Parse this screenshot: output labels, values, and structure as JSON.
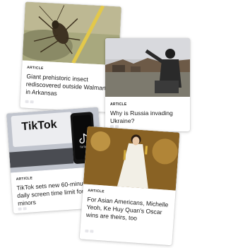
{
  "articles": [
    {
      "tag": "ARTICLE",
      "title": "Giant prehistoric insect rediscovered outside Walmart in Arkansas",
      "image": "insect-photo"
    },
    {
      "tag": "ARTICLE",
      "title": "Why is Russia invading Ukraine?",
      "image": "war-soldier-photo"
    },
    {
      "tag": "ARTICLE",
      "title": "TikTok sets new 60-minute daily screen time limit for minors",
      "image": "tiktok-phone-photo"
    },
    {
      "tag": "ARTICLE",
      "title": "For Asian Americans, Michelle Yeoh, Ke Huy Quan's Oscar wins are theirs, too",
      "image": "oscar-winner-photo"
    }
  ],
  "tiktok_logo_text": "TikTok",
  "tiktok_app_label": "TikTok"
}
